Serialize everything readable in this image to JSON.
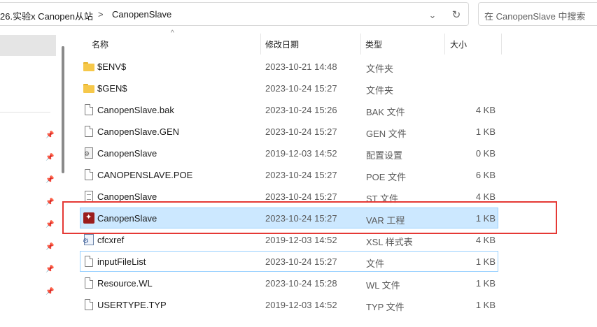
{
  "address_bar": {
    "crumb_parent": "26.实验x Canopen从站",
    "separator": ">",
    "crumb_current": "CanopenSlave",
    "dropdown_icon": "chevron-down-icon",
    "refresh_icon": "refresh-icon"
  },
  "search": {
    "placeholder": "在 CanopenSlave 中搜索"
  },
  "columns": {
    "name": "名称",
    "date": "修改日期",
    "type": "类型",
    "size": "大小",
    "sort_indicator": "^"
  },
  "files": [
    {
      "icon": "folder-icon",
      "name": "$ENV$",
      "date": "2023-10-21 14:48",
      "type": "文件夹",
      "size": ""
    },
    {
      "icon": "folder-icon",
      "name": "$GEN$",
      "date": "2023-10-24 15:27",
      "type": "文件夹",
      "size": ""
    },
    {
      "icon": "document-icon",
      "name": "CanopenSlave.bak",
      "date": "2023-10-24 15:26",
      "type": "BAK 文件",
      "size": "4 KB"
    },
    {
      "icon": "document-icon",
      "name": "CanopenSlave.GEN",
      "date": "2023-10-24 15:27",
      "type": "GEN 文件",
      "size": "1 KB"
    },
    {
      "icon": "config-settings-icon",
      "name": "CanopenSlave",
      "date": "2019-12-03 14:52",
      "type": "配置设置",
      "size": "0 KB"
    },
    {
      "icon": "document-icon",
      "name": "CANOPENSLAVE.POE",
      "date": "2023-10-24 15:27",
      "type": "POE 文件",
      "size": "6 KB"
    },
    {
      "icon": "st-file-icon",
      "name": "CanopenSlave",
      "date": "2023-10-24 15:27",
      "type": "ST 文件",
      "size": "4 KB"
    },
    {
      "icon": "var-project-icon",
      "name": "CanopenSlave",
      "date": "2023-10-24 15:27",
      "type": "VAR 工程",
      "size": "1 KB"
    },
    {
      "icon": "xsl-stylesheet-icon",
      "name": "cfcxref",
      "date": "2019-12-03 14:52",
      "type": "XSL 样式表",
      "size": "4 KB"
    },
    {
      "icon": "document-icon",
      "name": "inputFileList",
      "date": "2023-10-24 15:27",
      "type": "文件",
      "size": "1 KB"
    },
    {
      "icon": "document-icon",
      "name": "Resource.WL",
      "date": "2023-10-24 15:28",
      "type": "WL 文件",
      "size": "1 KB"
    },
    {
      "icon": "document-icon",
      "name": "USERTYPE.TYP",
      "date": "2019-12-03 14:52",
      "type": "TYP 文件",
      "size": "1 KB"
    }
  ],
  "selected_row": 7,
  "colors": {
    "selection": "#cce8ff",
    "selection_border": "#99d1ff",
    "annotation_red": "#e53935",
    "folder": "#f6c84a"
  }
}
